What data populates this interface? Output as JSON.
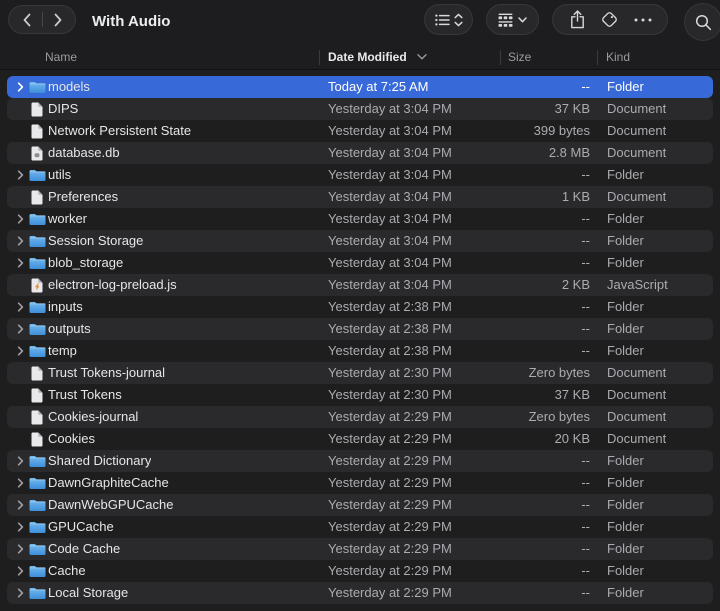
{
  "titlebar": {
    "title": "With Audio"
  },
  "toolbar": {
    "icons": [
      "chevron-left-icon",
      "chevron-right-icon",
      "list-view-icon",
      "updown-chevrons-icon",
      "group-view-icon",
      "chevron-down-icon",
      "share-icon",
      "tag-icon",
      "ellipsis-icon",
      "search-icon"
    ]
  },
  "columns": {
    "name": "Name",
    "date_modified": "Date Modified",
    "size": "Size",
    "kind": "Kind",
    "sorted_by": "Date Modified",
    "sort_direction": "descending"
  },
  "rows": [
    {
      "name": "models",
      "date": "Today at 7:25 AM",
      "size": "--",
      "kind": "Folder",
      "type": "folder",
      "selected": true
    },
    {
      "name": "DIPS",
      "date": "Yesterday at 3:04 PM",
      "size": "37 KB",
      "kind": "Document",
      "type": "document",
      "selected": false
    },
    {
      "name": "Network Persistent State",
      "date": "Yesterday at 3:04 PM",
      "size": "399 bytes",
      "kind": "Document",
      "type": "document",
      "selected": false
    },
    {
      "name": "database.db",
      "date": "Yesterday at 3:04 PM",
      "size": "2.8 MB",
      "kind": "Document",
      "type": "database",
      "selected": false
    },
    {
      "name": "utils",
      "date": "Yesterday at 3:04 PM",
      "size": "--",
      "kind": "Folder",
      "type": "folder",
      "selected": false
    },
    {
      "name": "Preferences",
      "date": "Yesterday at 3:04 PM",
      "size": "1 KB",
      "kind": "Document",
      "type": "document",
      "selected": false
    },
    {
      "name": "worker",
      "date": "Yesterday at 3:04 PM",
      "size": "--",
      "kind": "Folder",
      "type": "folder",
      "selected": false
    },
    {
      "name": "Session Storage",
      "date": "Yesterday at 3:04 PM",
      "size": "--",
      "kind": "Folder",
      "type": "folder",
      "selected": false
    },
    {
      "name": "blob_storage",
      "date": "Yesterday at 3:04 PM",
      "size": "--",
      "kind": "Folder",
      "type": "folder",
      "selected": false
    },
    {
      "name": "electron-log-preload.js",
      "date": "Yesterday at 3:04 PM",
      "size": "2 KB",
      "kind": "JavaScript",
      "type": "javascript",
      "selected": false
    },
    {
      "name": "inputs",
      "date": "Yesterday at 2:38 PM",
      "size": "--",
      "kind": "Folder",
      "type": "folder",
      "selected": false
    },
    {
      "name": "outputs",
      "date": "Yesterday at 2:38 PM",
      "size": "--",
      "kind": "Folder",
      "type": "folder",
      "selected": false
    },
    {
      "name": "temp",
      "date": "Yesterday at 2:38 PM",
      "size": "--",
      "kind": "Folder",
      "type": "folder",
      "selected": false
    },
    {
      "name": "Trust Tokens-journal",
      "date": "Yesterday at 2:30 PM",
      "size": "Zero bytes",
      "kind": "Document",
      "type": "document",
      "selected": false
    },
    {
      "name": "Trust Tokens",
      "date": "Yesterday at 2:30 PM",
      "size": "37 KB",
      "kind": "Document",
      "type": "document",
      "selected": false
    },
    {
      "name": "Cookies-journal",
      "date": "Yesterday at 2:29 PM",
      "size": "Zero bytes",
      "kind": "Document",
      "type": "document",
      "selected": false
    },
    {
      "name": "Cookies",
      "date": "Yesterday at 2:29 PM",
      "size": "20 KB",
      "kind": "Document",
      "type": "document",
      "selected": false
    },
    {
      "name": "Shared Dictionary",
      "date": "Yesterday at 2:29 PM",
      "size": "--",
      "kind": "Folder",
      "type": "folder",
      "selected": false
    },
    {
      "name": "DawnGraphiteCache",
      "date": "Yesterday at 2:29 PM",
      "size": "--",
      "kind": "Folder",
      "type": "folder",
      "selected": false
    },
    {
      "name": "DawnWebGPUCache",
      "date": "Yesterday at 2:29 PM",
      "size": "--",
      "kind": "Folder",
      "type": "folder",
      "selected": false
    },
    {
      "name": "GPUCache",
      "date": "Yesterday at 2:29 PM",
      "size": "--",
      "kind": "Folder",
      "type": "folder",
      "selected": false
    },
    {
      "name": "Code Cache",
      "date": "Yesterday at 2:29 PM",
      "size": "--",
      "kind": "Folder",
      "type": "folder",
      "selected": false
    },
    {
      "name": "Cache",
      "date": "Yesterday at 2:29 PM",
      "size": "--",
      "kind": "Folder",
      "type": "folder",
      "selected": false
    },
    {
      "name": "Local Storage",
      "date": "Yesterday at 2:29 PM",
      "size": "--",
      "kind": "Folder",
      "type": "folder",
      "selected": false
    }
  ],
  "row_icons": {
    "folder": "folder-icon",
    "document": "document-icon",
    "database": "database-document-icon",
    "javascript": "javascript-document-icon",
    "disclosure": "chevron-right-icon"
  },
  "colors": {
    "selection_blue": "#3869d8",
    "folder_blue_top": "#74b9ee",
    "folder_blue_bottom": "#3d8edb",
    "javascript_orange": "#e8892f",
    "row_stripe": "#2a2a2c",
    "background": "#1e1e1f",
    "text_primary": "#e6e6e8",
    "text_secondary": "#ababb0"
  }
}
